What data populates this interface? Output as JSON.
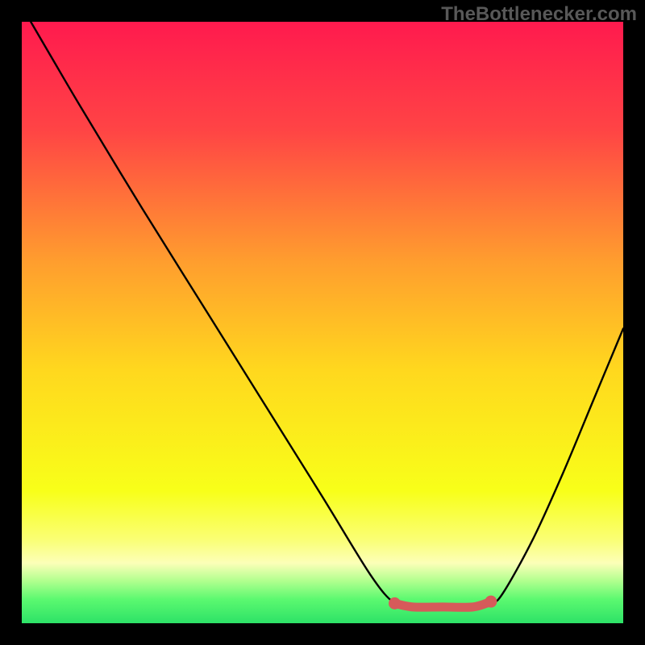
{
  "watermark": "TheBottlenecker.com",
  "chart_data": {
    "type": "line",
    "title": "",
    "xlabel": "",
    "ylabel": "",
    "xlim": [
      0,
      100
    ],
    "ylim": [
      0,
      100
    ],
    "gradient_stops": [
      {
        "offset": 0,
        "color": "#ff1a4e"
      },
      {
        "offset": 18,
        "color": "#ff4445"
      },
      {
        "offset": 40,
        "color": "#ff9e2e"
      },
      {
        "offset": 58,
        "color": "#ffd81e"
      },
      {
        "offset": 78,
        "color": "#f8ff19"
      },
      {
        "offset": 86,
        "color": "#faff73"
      },
      {
        "offset": 90,
        "color": "#fcffb8"
      },
      {
        "offset": 93,
        "color": "#b0ff8e"
      },
      {
        "offset": 96,
        "color": "#5cf970"
      },
      {
        "offset": 100,
        "color": "#2de267"
      }
    ],
    "series": [
      {
        "name": "bottleneck-curve",
        "color": "#000000",
        "points": [
          {
            "x": 1.5,
            "y": 100
          },
          {
            "x": 5,
            "y": 94
          },
          {
            "x": 10,
            "y": 85.5
          },
          {
            "x": 20,
            "y": 69
          },
          {
            "x": 30,
            "y": 53
          },
          {
            "x": 40,
            "y": 37
          },
          {
            "x": 50,
            "y": 21
          },
          {
            "x": 58,
            "y": 8
          },
          {
            "x": 62,
            "y": 3.3
          },
          {
            "x": 65,
            "y": 2.7
          },
          {
            "x": 70,
            "y": 2.7
          },
          {
            "x": 75,
            "y": 2.7
          },
          {
            "x": 78,
            "y": 3.3
          },
          {
            "x": 80,
            "y": 5
          },
          {
            "x": 85,
            "y": 14
          },
          {
            "x": 90,
            "y": 25
          },
          {
            "x": 95,
            "y": 37
          },
          {
            "x": 100,
            "y": 49
          }
        ]
      },
      {
        "name": "bottleneck-highlight",
        "color": "#d65a5a",
        "type": "segment",
        "points": [
          {
            "x": 62,
            "y": 3.3
          },
          {
            "x": 65,
            "y": 2.7
          },
          {
            "x": 70,
            "y": 2.7
          },
          {
            "x": 75,
            "y": 2.7
          },
          {
            "x": 78,
            "y": 3.6
          }
        ],
        "endpoints": [
          {
            "x": 62,
            "y": 3.3
          },
          {
            "x": 78,
            "y": 3.6
          }
        ]
      }
    ]
  }
}
